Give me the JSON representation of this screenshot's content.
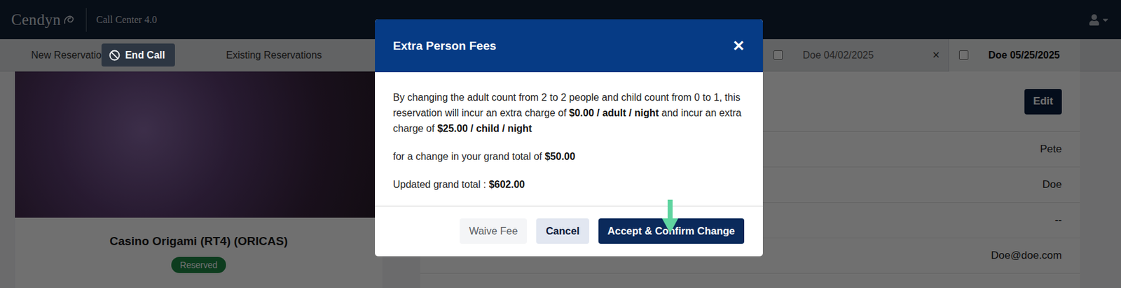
{
  "navbar": {
    "brand": "Cendyn",
    "app_title": "Call Center 4.0"
  },
  "nav_tabs": [
    {
      "label": "New Reservatio",
      "selected": false
    }
  ],
  "end_call": {
    "label": "End Call"
  },
  "nav_links": [
    {
      "label": "Existing Reservations",
      "selected": false
    }
  ],
  "reservation_tabs": [
    {
      "label": "Doe 04/02/2025",
      "checked": false,
      "selected": false,
      "close": "×"
    },
    {
      "label": "Doe 05/25/2025",
      "checked": false,
      "selected": true,
      "close": ""
    }
  ],
  "room": {
    "name": "Casino Origami (RT4) (ORICAS)",
    "status": "Reserved"
  },
  "details": {
    "edit": "Edit",
    "values": [
      "Pete",
      "Doe",
      "--",
      "Doe@doe.com"
    ]
  },
  "modal": {
    "title": "Extra Person Fees",
    "close": "✕",
    "paragraphs": [
      [
        {
          "text": "By changing the adult count from 2 to 2 people and child count from 0 to 1, this reservation will incur an extra charge of ",
          "bold": false
        },
        {
          "text": "$0.00 / adult / night",
          "bold": true
        },
        {
          "text": " and incur an extra charge of ",
          "bold": false
        },
        {
          "text": "$25.00 / child / night",
          "bold": true
        }
      ],
      [
        {
          "text": "for a change in your grand total of ",
          "bold": false
        },
        {
          "text": "$50.00",
          "bold": true
        }
      ],
      [
        {
          "text": "Updated grand total : ",
          "bold": false
        },
        {
          "text": "$602.00",
          "bold": true
        }
      ]
    ],
    "buttons": [
      {
        "label": "Waive Fee",
        "kind": "ghost"
      },
      {
        "label": "Cancel",
        "kind": "secondary"
      },
      {
        "label": "Accept & Confirm Change",
        "kind": "primary"
      }
    ]
  }
}
